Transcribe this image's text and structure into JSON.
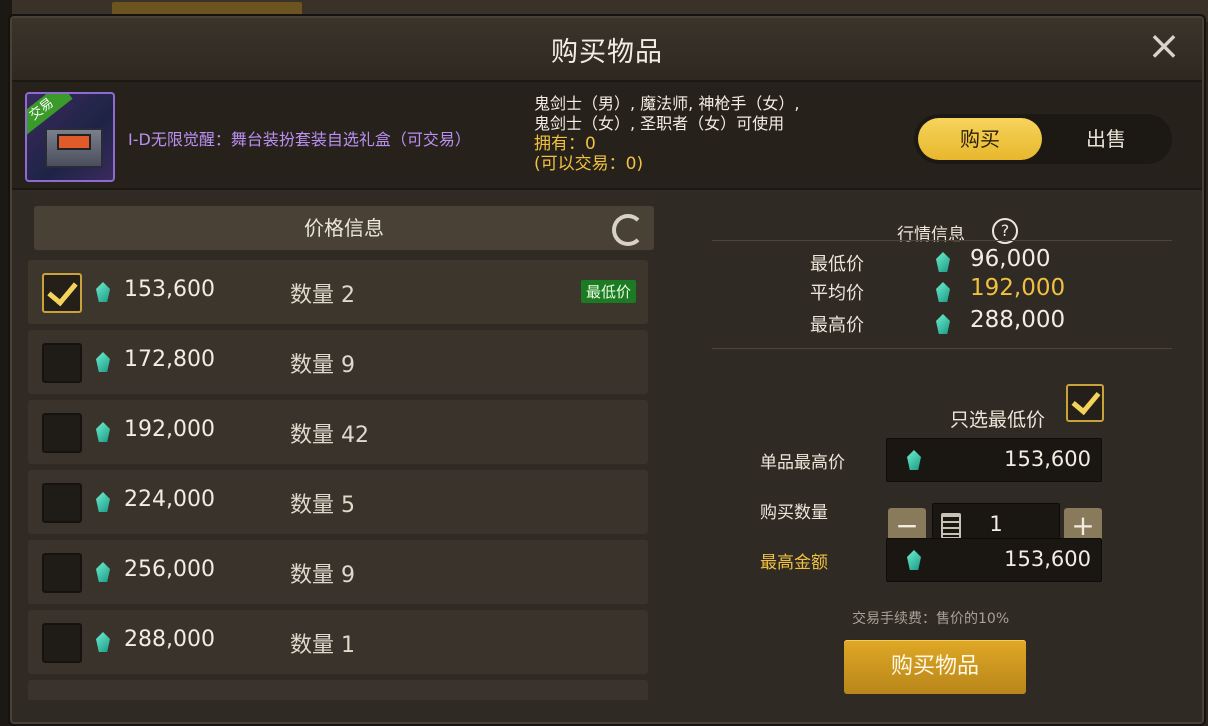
{
  "dialog": {
    "title": "购买物品",
    "close_icon": "×"
  },
  "item": {
    "badge": "交易",
    "name": "I-D无限觉醒：舞台装扮套装自选礼盒（可交易）",
    "classes_line1": "鬼剑士（男）, 魔法师, 神枪手（女）,",
    "classes_line2": "鬼剑士（女）, 圣职者（女）可使用",
    "owned": "拥有：0",
    "tradable": "(可以交易：0)"
  },
  "toggle": {
    "buy_label": "购买",
    "sell_label": "出售",
    "active": "buy"
  },
  "price_panel": {
    "title": "价格信息",
    "lowest_badge": "最低价",
    "rows": [
      {
        "price": "153,600",
        "qty": "数量 2",
        "checked": true,
        "lowest": true
      },
      {
        "price": "172,800",
        "qty": "数量 9",
        "checked": false,
        "lowest": false
      },
      {
        "price": "192,000",
        "qty": "数量 42",
        "checked": false,
        "lowest": false
      },
      {
        "price": "224,000",
        "qty": "数量 5",
        "checked": false,
        "lowest": false
      },
      {
        "price": "256,000",
        "qty": "数量 9",
        "checked": false,
        "lowest": false
      },
      {
        "price": "288,000",
        "qty": "数量 1",
        "checked": false,
        "lowest": false
      }
    ]
  },
  "market": {
    "title": "行情信息",
    "help_icon": "?",
    "lowest_label": "最低价",
    "lowest_value": "96,000",
    "average_label": "平均价",
    "average_value": "192,000",
    "highest_label": "最高价",
    "highest_value": "288,000"
  },
  "form": {
    "only_lowest_label": "只选最低价",
    "only_lowest_checked": true,
    "max_unit_label": "单品最高价",
    "max_unit_value": "153,600",
    "quantity_label": "购买数量",
    "quantity_value": "1",
    "minus_label": "−",
    "plus_label": "+",
    "max_total_label": "最高金额",
    "max_total_value": "153,600",
    "fee_note": "交易手续费：售价的10%",
    "buy_button": "购买物品"
  },
  "colors": {
    "gold": "#f0c040",
    "lowest_badge_bg": "#1d7a24",
    "item_name": "#b98ff0"
  }
}
